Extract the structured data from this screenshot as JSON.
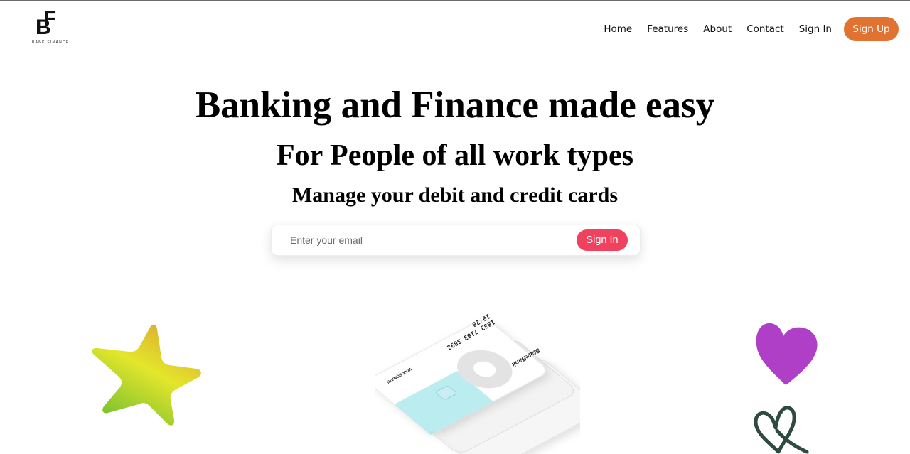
{
  "brand": {
    "logo_letters": "BF",
    "logo_subtext": "BANK FINANCE"
  },
  "nav": {
    "items": [
      {
        "label": "Home"
      },
      {
        "label": "Features"
      },
      {
        "label": "About"
      },
      {
        "label": "Contact"
      },
      {
        "label": "Sign In"
      }
    ],
    "signup_label": "Sign Up"
  },
  "hero": {
    "title": "Banking and Finance made easy",
    "subtitle": "For People of all work types",
    "tagline": "Manage your debit and credit cards"
  },
  "email_form": {
    "placeholder": "Enter your email",
    "button_label": "Sign In"
  },
  "illustration": {
    "card_brand": "StateBank",
    "card_number": "1833 7163 3892",
    "card_expiry": "10/28",
    "card_holder": "WAX SONARI"
  },
  "colors": {
    "signup_button": "#e07332",
    "signin_button": "#f0415e",
    "star_gradient": [
      "#d9b42c",
      "#e6e82a",
      "#7cc22e"
    ],
    "heart": "#b03fc8",
    "heart_outline": "#2f4a42",
    "card_accent": "#a9e7ec"
  }
}
